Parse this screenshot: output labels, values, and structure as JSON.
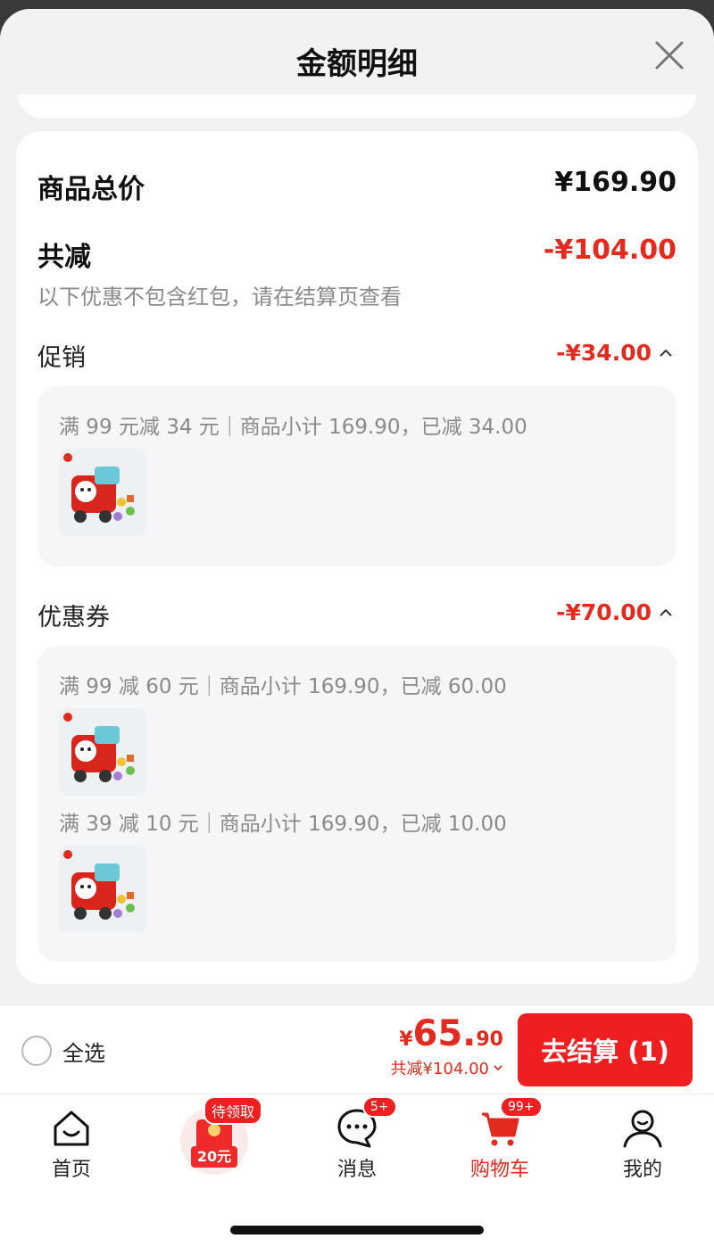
{
  "header": {
    "title": "金额明细"
  },
  "summary": {
    "total_label": "商品总价",
    "total_value": "¥169.90",
    "reduce_label": "共减",
    "reduce_value": "-¥104.00",
    "note": "以下优惠不包含红包，请在结算页查看"
  },
  "promotion": {
    "label": "促销",
    "value": "-¥34.00",
    "items": [
      {
        "text": "满 99 元减 34 元｜商品小计 169.90，已减 34.00"
      }
    ]
  },
  "coupon": {
    "label": "优惠券",
    "value": "-¥70.00",
    "items": [
      {
        "text": "满 99 减 60 元｜商品小计 169.90，已减 60.00"
      },
      {
        "text": "满 39 减 10 元｜商品小计 169.90，已减 10.00"
      }
    ]
  },
  "bottom_bar": {
    "select_all": "全选",
    "amount_yen": "¥",
    "amount_int": "65.",
    "amount_dec": "90",
    "discount_text": "共减¥104.00",
    "checkout_label": "去结算 (1)"
  },
  "tabs": [
    {
      "label": "首页",
      "icon": "home-icon"
    },
    {
      "label": "",
      "icon": "red-packet-icon",
      "badge": "待领取",
      "packet_amount": "20元"
    },
    {
      "label": "消息",
      "icon": "message-icon",
      "badge": "5+"
    },
    {
      "label": "购物车",
      "icon": "cart-icon",
      "badge": "99+",
      "active": true
    },
    {
      "label": "我的",
      "icon": "profile-icon"
    }
  ],
  "colors": {
    "accent": "#e22b1e",
    "button": "#ee1f20"
  }
}
